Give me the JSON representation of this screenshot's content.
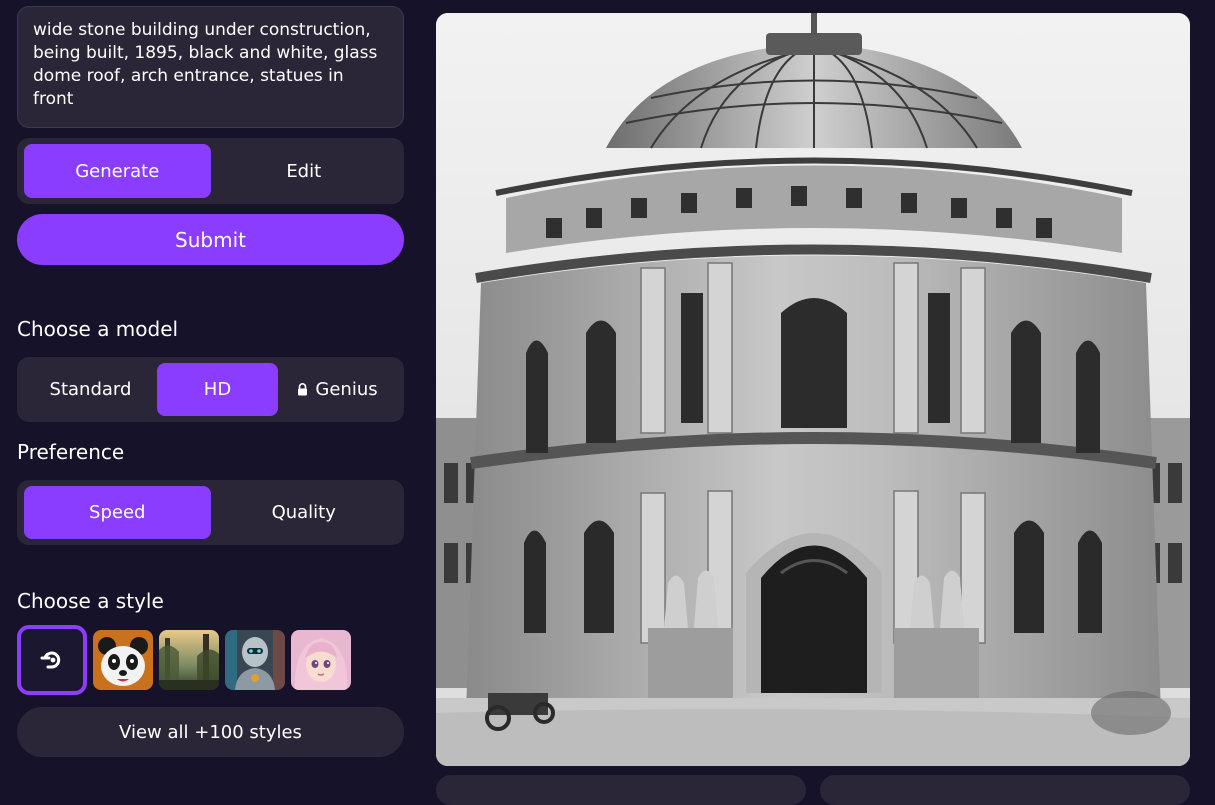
{
  "prompt": {
    "text": "wide stone building under construction, being built, 1895, black and white, glass dome roof, arch entrance, statues in front"
  },
  "mode_toggle": {
    "options": [
      "Generate",
      "Edit"
    ],
    "selected": "Generate"
  },
  "submit_label": "Submit",
  "model": {
    "heading": "Choose a model",
    "options": [
      "Standard",
      "HD",
      "Genius"
    ],
    "selected": "HD",
    "locked": [
      "Genius"
    ]
  },
  "preference": {
    "heading": "Preference",
    "options": [
      "Speed",
      "Quality"
    ],
    "selected": "Speed"
  },
  "style": {
    "heading": "Choose a style",
    "thumbnails": [
      "no-style-icon",
      "panda",
      "forest-landscape",
      "robot",
      "anime-girl"
    ],
    "selected": "no-style-icon",
    "view_all_label": "View all +100 styles"
  },
  "colors": {
    "accent": "#8b3dff",
    "background": "#16122a",
    "panel": "#2a2638"
  }
}
